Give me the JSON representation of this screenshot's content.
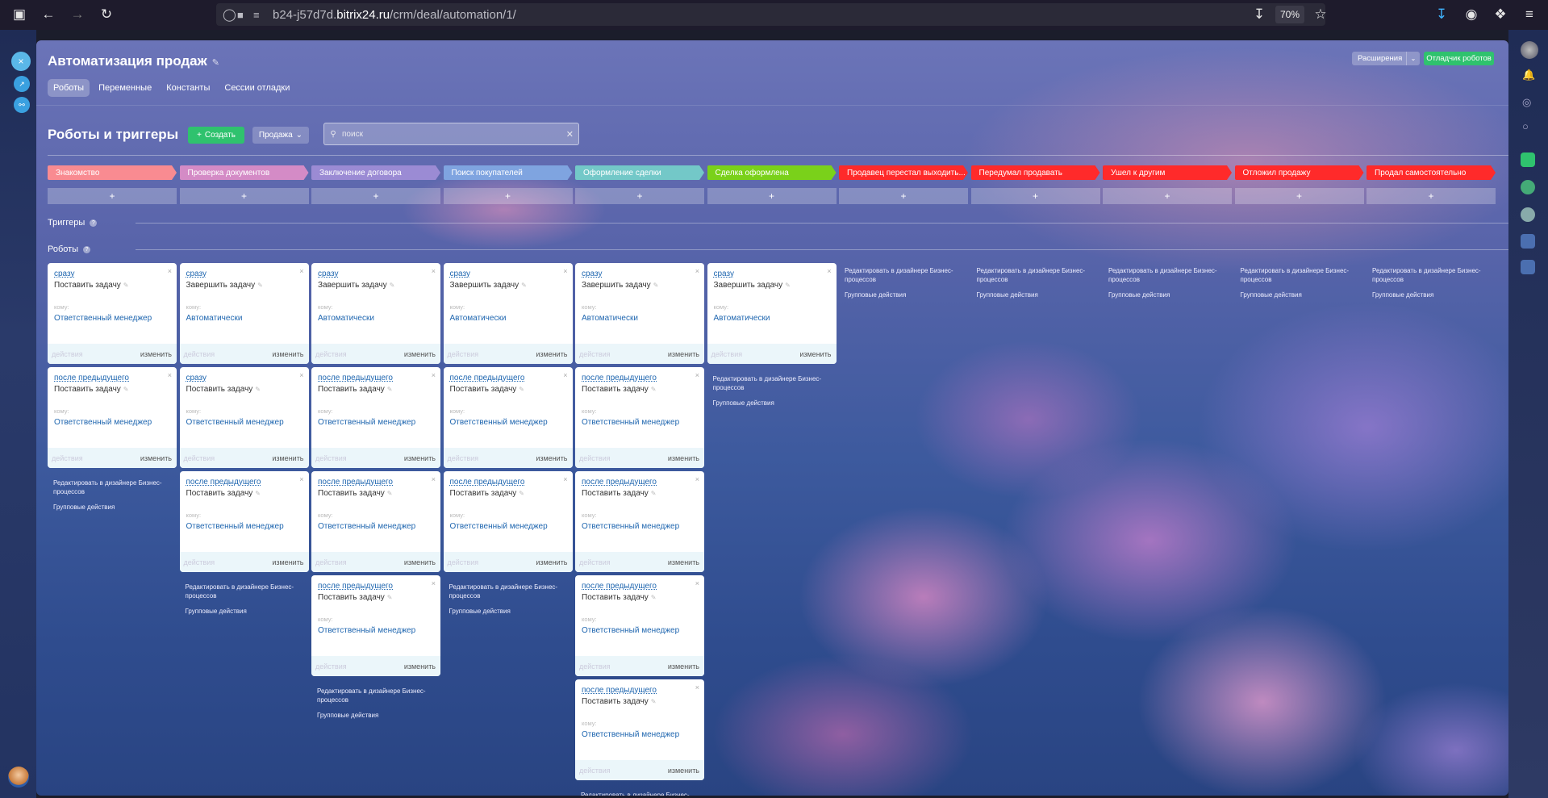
{
  "browser": {
    "url_prefix": "b24-j57d7d.",
    "url_host": "bitrix24.ru",
    "url_path": "/crm/deal/automation/1/",
    "zoom": "70%"
  },
  "page": {
    "title": "Автоматизация продаж",
    "tabs": [
      "Роботы",
      "Переменные",
      "Константы",
      "Сессии отладки"
    ],
    "extensions_label": "Расширения",
    "debugger_label": "Отладчик роботов"
  },
  "section": {
    "title": "Роботы и триггеры",
    "create_label": "Создать",
    "category_label": "Продажа",
    "search_placeholder": "поиск",
    "triggers_label": "Триггеры",
    "robots_label": "Роботы"
  },
  "stages": [
    {
      "label": "Знакомство",
      "color": "#f98b91"
    },
    {
      "label": "Проверка документов",
      "color": "#d48bc6"
    },
    {
      "label": "Заключение договора",
      "color": "#9b8bd4"
    },
    {
      "label": "Поиск покупателей",
      "color": "#7fa4e0"
    },
    {
      "label": "Оформление сделки",
      "color": "#73c8c8"
    },
    {
      "label": "Сделка оформлена",
      "color": "#7ad11a"
    },
    {
      "label": "Продавец перестал выходить...",
      "color": "#ff2a2a"
    },
    {
      "label": "Передумал продавать",
      "color": "#ff2a2a"
    },
    {
      "label": "Ушел к другим",
      "color": "#ff2a2a"
    },
    {
      "label": "Отложил продажу",
      "color": "#ff2a2a"
    },
    {
      "label": "Продал самостоятельно",
      "color": "#ff2a2a"
    }
  ],
  "plus_sign": "+",
  "card_labels": {
    "whom": "кому:",
    "actions": "действия",
    "change": "изменить",
    "close": "×"
  },
  "columns": [
    [
      {
        "when": "сразу",
        "title": "Поставить задачу",
        "who": "Ответственный менеджер"
      },
      {
        "when": "после предыдущего",
        "title": "Поставить задачу",
        "who": "Ответственный менеджер"
      }
    ],
    [
      {
        "when": "сразу",
        "title": "Завершить задачу",
        "who": "Автоматически"
      },
      {
        "when": "сразу",
        "title": "Поставить задачу",
        "who": "Ответственный менеджер"
      },
      {
        "when": "после предыдущего",
        "title": "Поставить задачу",
        "who": "Ответственный менеджер"
      }
    ],
    [
      {
        "when": "сразу",
        "title": "Завершить задачу",
        "who": "Автоматически"
      },
      {
        "when": "после предыдущего",
        "title": "Поставить задачу",
        "who": "Ответственный менеджер"
      },
      {
        "when": "после предыдущего",
        "title": "Поставить задачу",
        "who": "Ответственный менеджер"
      },
      {
        "when": "после предыдущего",
        "title": "Поставить задачу",
        "who": "Ответственный менеджер"
      }
    ],
    [
      {
        "when": "сразу",
        "title": "Завершить задачу",
        "who": "Автоматически"
      },
      {
        "when": "после предыдущего",
        "title": "Поставить задачу",
        "who": "Ответственный менеджер"
      },
      {
        "when": "после предыдущего",
        "title": "Поставить задачу",
        "who": "Ответственный менеджер"
      }
    ],
    [
      {
        "when": "сразу",
        "title": "Завершить задачу",
        "who": "Автоматически"
      },
      {
        "when": "после предыдущего",
        "title": "Поставить задачу",
        "who": "Ответственный менеджер"
      },
      {
        "when": "после предыдущего",
        "title": "Поставить задачу",
        "who": "Ответственный менеджер"
      },
      {
        "when": "после предыдущего",
        "title": "Поставить задачу",
        "who": "Ответственный менеджер"
      },
      {
        "when": "после предыдущего",
        "title": "Поставить задачу",
        "who": "Ответственный менеджер"
      }
    ],
    [
      {
        "when": "сразу",
        "title": "Завершить задачу",
        "who": "Автоматически"
      }
    ],
    [],
    [],
    [],
    [],
    []
  ],
  "edit_designer": "Редактировать в дизайнере Бизнес-процессов",
  "group_actions": "Групповые действия"
}
